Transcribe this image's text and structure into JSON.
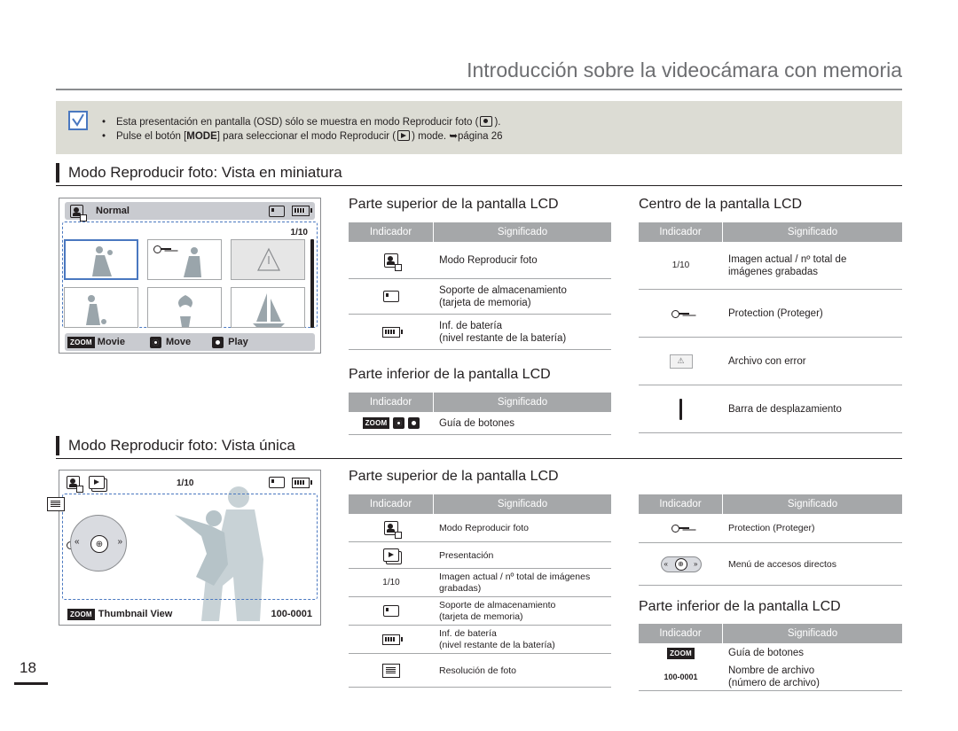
{
  "header": {
    "title": "Introducción sobre la videocámara con memoria"
  },
  "note": {
    "line1_pre": "Esta presentación en pantalla (OSD) sólo se muestra en modo Reproducir foto (",
    "line1_post": ").",
    "line2_a": "Pulse el botón [",
    "line2_key": "MODE",
    "line2_b": "] para seleccionar el modo Reproducir (",
    "line2_c": ") mode. ",
    "line2_arrow": "➥",
    "line2_d": "página 26"
  },
  "sections": {
    "thumbnail": "Modo Reproducir foto: Vista en miniatura",
    "single": "Modo Reproducir foto: Vista única"
  },
  "table_headers": {
    "indicator": "Indicador",
    "meaning": "Significado"
  },
  "thumb_top": {
    "heading": "Parte superior de la pantalla LCD",
    "rows": [
      {
        "icon": "photo-play-icon",
        "text": "Modo Reproducir foto"
      },
      {
        "icon": "memory-card-icon",
        "text1": "Soporte de almacenamiento",
        "text2": "(tarjeta de memoria)"
      },
      {
        "icon": "battery-icon",
        "text1": "Inf. de batería",
        "text2": "(nivel restante de la batería)"
      }
    ]
  },
  "thumb_bottom": {
    "heading": "Parte inferior de la pantalla LCD",
    "rows": [
      {
        "icon": "zoom-joystick-icons",
        "zoom": "ZOOM",
        "text": "Guía de botones"
      }
    ]
  },
  "thumb_center": {
    "heading": "Centro de la pantalla LCD",
    "rows": [
      {
        "indicator": "1/10",
        "text1": "Imagen actual / nº total de",
        "text2": "imágenes grabadas"
      },
      {
        "icon": "key-protect-icon",
        "text": "Protection (Proteger)"
      },
      {
        "icon": "warning-icon",
        "text": "Archivo con error"
      },
      {
        "icon": "scroll-bar-icon",
        "text": "Barra de desplazamiento"
      }
    ]
  },
  "single_top": {
    "heading": "Parte superior de la pantalla LCD",
    "rows": [
      {
        "icon": "photo-play-icon",
        "text": "Modo Reproducir foto"
      },
      {
        "icon": "slideshow-icon",
        "text": "Presentación"
      },
      {
        "indicator": "1/10",
        "text1": "Imagen actual / nº total de imágenes",
        "text2": "grabadas)"
      },
      {
        "icon": "memory-card-icon",
        "text1": "Soporte de almacenamiento",
        "text2": "(tarjeta de memoria)"
      },
      {
        "icon": "battery-icon",
        "text1": "Inf. de batería",
        "text2": "(nivel restante de la batería)"
      },
      {
        "icon": "resolution-icon",
        "text": "Resolución de foto"
      }
    ]
  },
  "single_right": {
    "rows": [
      {
        "icon": "key-protect-icon",
        "text": "Protection (Proteger)"
      },
      {
        "icon": "shortcut-menu-icon",
        "text": "Menú de accesos directos"
      }
    ]
  },
  "single_bottom": {
    "heading": "Parte inferior de la pantalla LCD",
    "rows": [
      {
        "zoom": "ZOOM",
        "text": "Guía de botones"
      },
      {
        "indicator": "100-0001",
        "text1": "Nombre de archivo",
        "text2": "(número de archivo)"
      }
    ]
  },
  "lcd_thumb": {
    "mode_label": "Normal",
    "counter": "1/10",
    "zoom": "ZOOM",
    "movie": "Movie",
    "move": "Move",
    "play": "Play"
  },
  "lcd_single": {
    "counter": "1/10",
    "zoom": "ZOOM",
    "view": "Thumbnail View",
    "file": "100-0001"
  },
  "page_number": "18",
  "colors": {
    "header_gray": "#a5a7a9",
    "note_bg": "#dcdcd4",
    "accent_blue": "#4a78c0",
    "title_gray": "#6d6e71"
  }
}
